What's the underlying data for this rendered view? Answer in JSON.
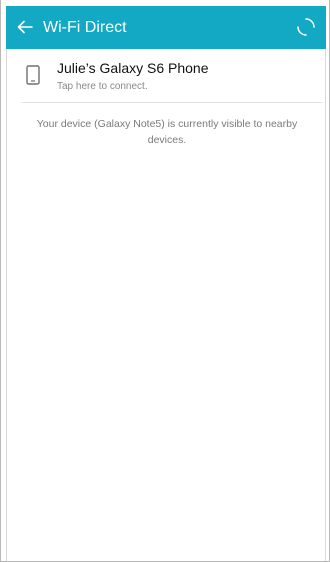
{
  "app_bar": {
    "title": "Wi-Fi Direct",
    "background_color": "#13a8c4",
    "back_icon": "arrow-left-icon",
    "refresh_icon": "refresh-icon"
  },
  "devices": [
    {
      "icon": "phone-icon",
      "name": "Julie’s Galaxy S6 Phone",
      "status": "Tap here to connect."
    }
  ],
  "visibility_note": "Your device (Galaxy Note5) is currently visible to nearby devices."
}
